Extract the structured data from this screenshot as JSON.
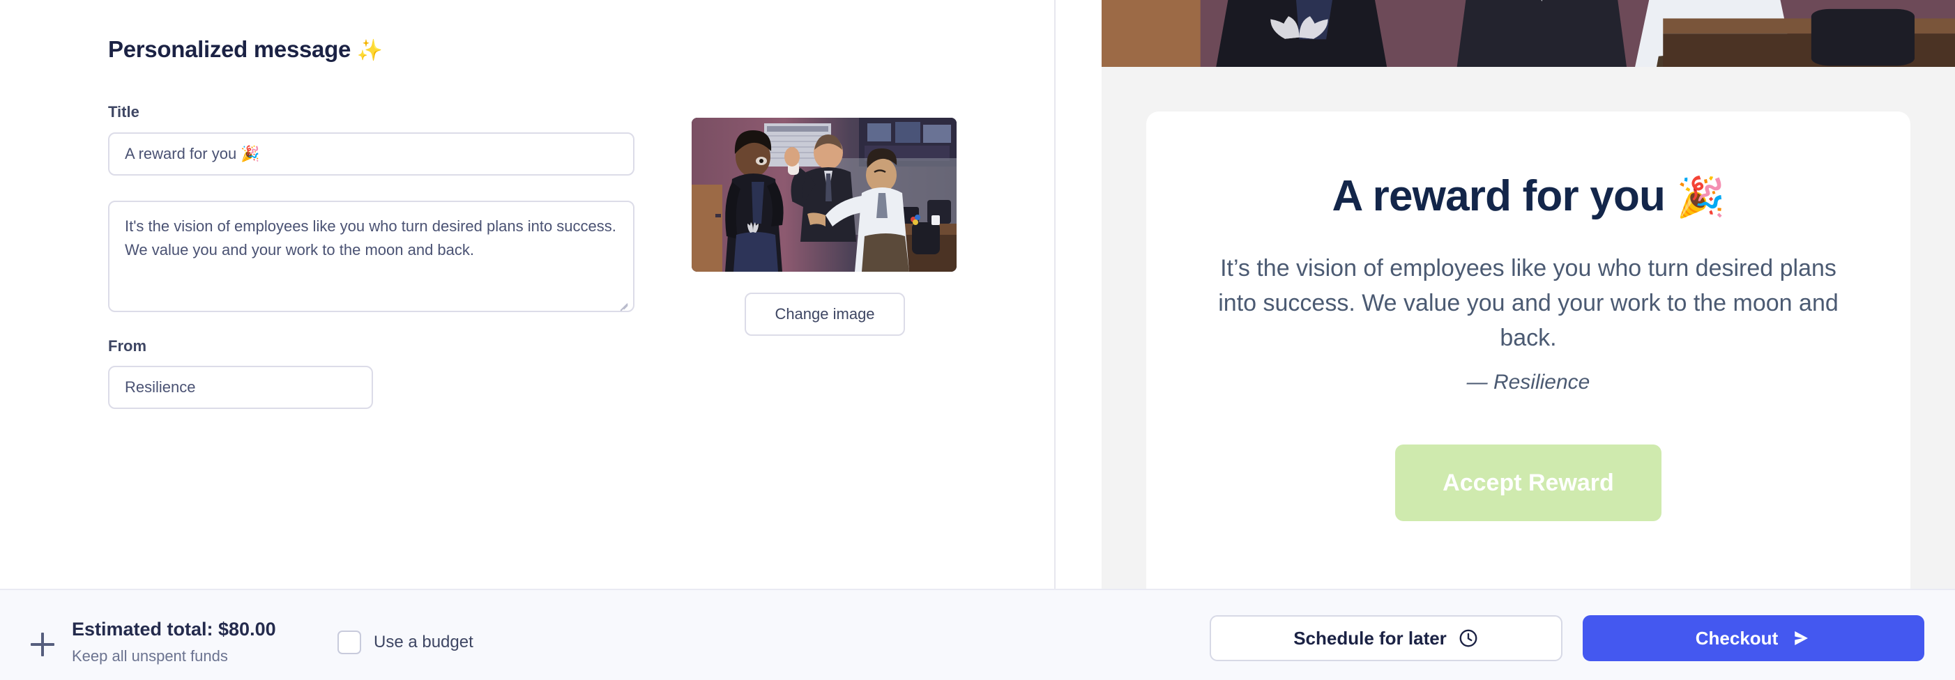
{
  "editor": {
    "section_title": "Personalized message",
    "section_title_emoji": "✨",
    "title_label": "Title",
    "title_value": "A reward for you 🎉",
    "title_placeholder": "Title",
    "message_value": "It's the vision of employees like you who turn desired plans into success. We value you and your work to the moon and back.",
    "message_placeholder": "Write your message",
    "from_label": "From",
    "from_value": "Resilience",
    "from_placeholder": "From",
    "change_image_label": "Change image",
    "image_alt": "office-high-five-gif-thumbnail"
  },
  "preview": {
    "heading": "A reward for you ",
    "heading_emoji": "🎉",
    "body": "It’s the vision of employees like you who turn desired plans into success. We value you and your work to the moon and back.",
    "signature": "— Resilience",
    "accept_label": "Accept Reward",
    "banner_alt": "office-high-five-gif-banner"
  },
  "bottom": {
    "expand_icon": "plus-icon",
    "total_label": "Estimated total: $80.00",
    "total_sub": "Keep all unspent funds",
    "budget_label": "Use a budget",
    "budget_checked": false,
    "schedule_label": "Schedule for later",
    "schedule_icon": "clock-icon",
    "checkout_label": "Checkout",
    "checkout_icon": "send-arrow-icon"
  },
  "colors": {
    "accent_blue": "#4458f0",
    "heading_navy": "#13264a",
    "accept_green": "#cfeaae",
    "bar_bg": "#f8f9fd",
    "preview_bg": "#f3f3f3"
  }
}
